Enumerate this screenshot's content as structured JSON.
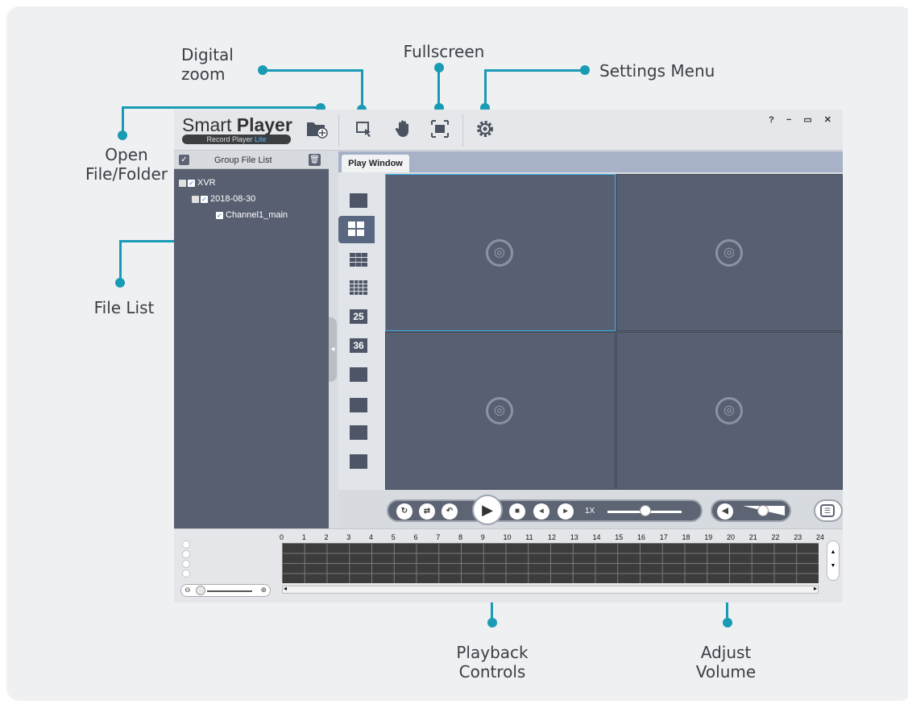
{
  "callouts": {
    "digital_zoom": "Digital\nzoom",
    "fullscreen": "Fullscreen",
    "settings_menu": "Settings Menu",
    "open_file_folder": "Open\nFile/Folder",
    "file_list": "File List",
    "playback_controls": "Playback\nControls",
    "adjust_volume": "Adjust\nVolume"
  },
  "app": {
    "brand_light": "Smart ",
    "brand_bold": "Player",
    "sub_brand": "Record Player ",
    "sub_brand_lite": "Lite",
    "window_controls": "? − ▭ ✕"
  },
  "file_panel": {
    "header": "Group File List",
    "tree": [
      {
        "label": "XVR",
        "level": 0
      },
      {
        "label": "2018-08-30",
        "level": 1
      },
      {
        "label": "Channel1_main",
        "level": 2
      }
    ]
  },
  "play_window": {
    "tab": "Play Window",
    "layout_labels": [
      "25",
      "36"
    ]
  },
  "controls": {
    "speed": "1X"
  },
  "timeline": {
    "hours": [
      "0",
      "1",
      "2",
      "3",
      "4",
      "5",
      "6",
      "7",
      "8",
      "9",
      "10",
      "11",
      "12",
      "13",
      "14",
      "15",
      "16",
      "17",
      "18",
      "19",
      "20",
      "21",
      "22",
      "23",
      "24"
    ]
  },
  "accent_color": "#1a9bb5",
  "icons": [
    "open-folder-icon",
    "digital-zoom-icon",
    "hand-icon",
    "fullscreen-icon",
    "settings-gear-icon",
    "camera-icon",
    "play-icon",
    "stop-icon",
    "volume-icon"
  ]
}
